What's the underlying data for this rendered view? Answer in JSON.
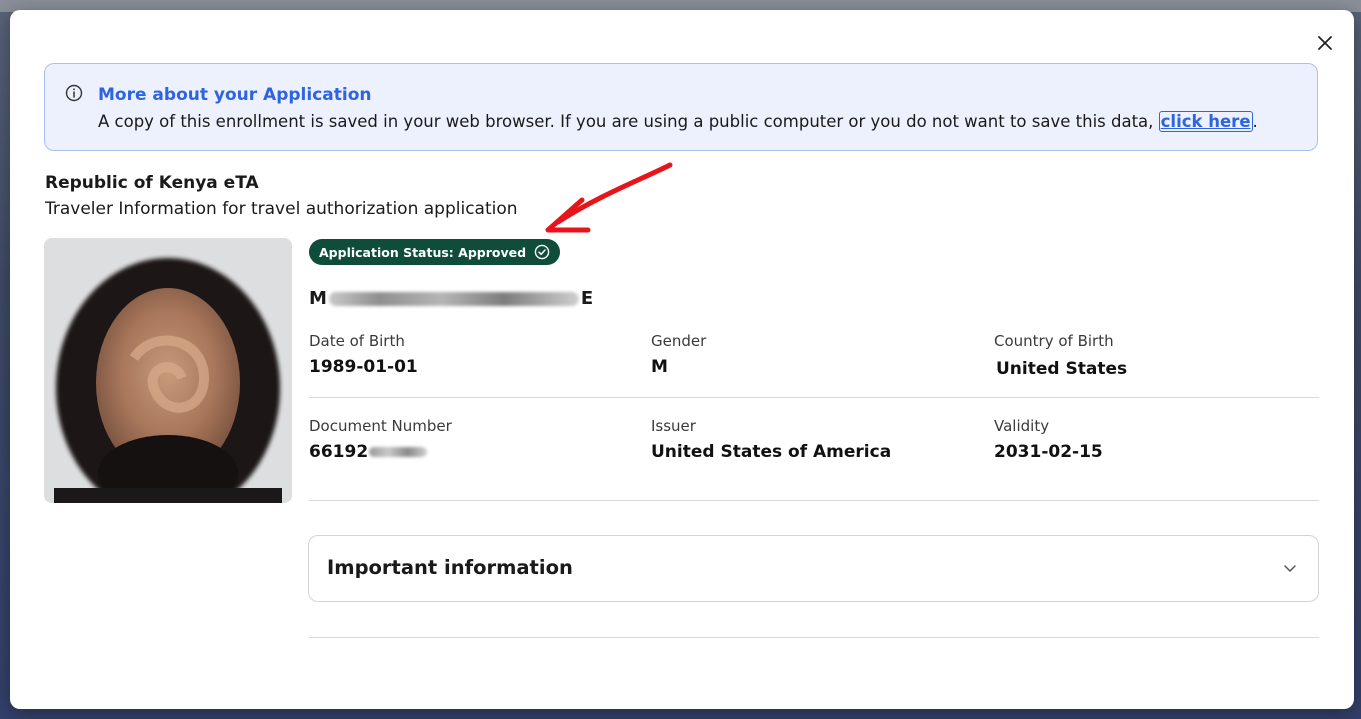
{
  "banner": {
    "title": "More about your Application",
    "text": "A copy of this enrollment is saved in your web browser. If you are using a public computer or you do not want to save this data, ",
    "link_label": "click here",
    "trailing": "."
  },
  "application": {
    "title": "Republic of Kenya eTA",
    "subtitle": "Traveler Information for travel authorization application",
    "status_label": "Application Status: Approved"
  },
  "traveler": {
    "name_start": "M",
    "name_end": "E",
    "fields": {
      "dob_label": "Date of Birth",
      "dob_value": "1989-01-01",
      "gender_label": "Gender",
      "gender_value": "M",
      "cob_label": "Country of Birth",
      "cob_value": "United States",
      "docnum_label": "Document Number",
      "docnum_value": "66192",
      "issuer_label": "Issuer",
      "issuer_value": "United States of America",
      "validity_label": "Validity",
      "validity_value": "2031-02-15"
    }
  },
  "accordion": {
    "title": "Important information"
  },
  "colors": {
    "accent": "#2f64e0",
    "badge_bg": "#0f4d3a",
    "banner_bg": "#ecf1fd",
    "annotation_arrow": "#e8141b"
  },
  "icons": {
    "close": "close-icon",
    "info": "info-icon",
    "status": "check-circle-icon",
    "accordion": "chevron-down-icon"
  }
}
